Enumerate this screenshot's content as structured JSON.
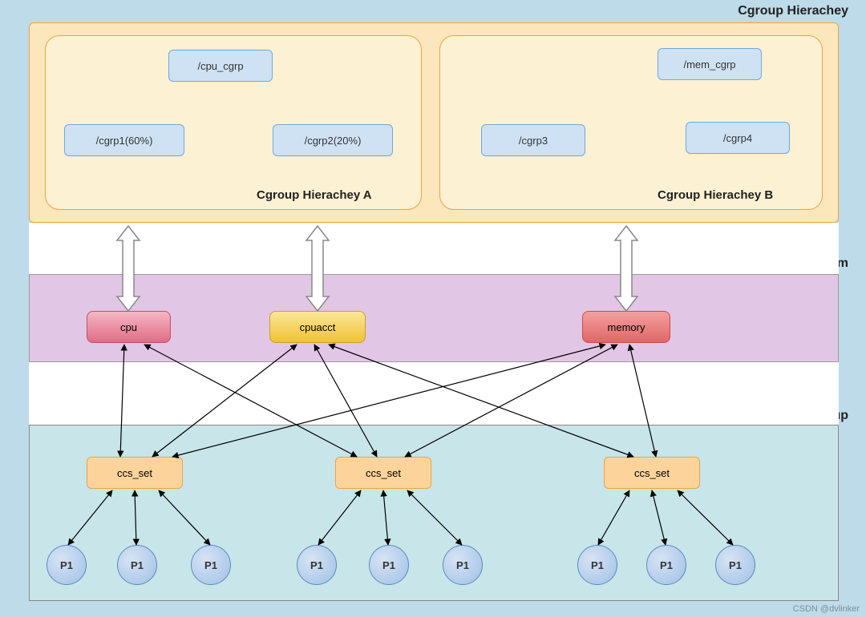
{
  "sections": {
    "hierarchy_title": "Cgroup Hierachey",
    "subsystem_title": "subsytem",
    "control_title": "control group"
  },
  "hierarchies": {
    "a": {
      "label": "Cgroup Hierachey A",
      "root": "/cpu_cgrp",
      "child1": "/cgrp1(60%)",
      "child2": "/cgrp2(20%)"
    },
    "b": {
      "label": "Cgroup Hierachey B",
      "root": "/mem_cgrp",
      "child1": "/cgrp3",
      "child2": "/cgrp4"
    }
  },
  "subsystems": {
    "cpu": "cpu",
    "cpuacct": "cpuacct",
    "memory": "memory"
  },
  "ccs": {
    "s1": "ccs_set",
    "s2": "ccs_set",
    "s3": "ccs_set"
  },
  "procs": {
    "p": "P1"
  },
  "watermark": "CSDN @dvlinker"
}
